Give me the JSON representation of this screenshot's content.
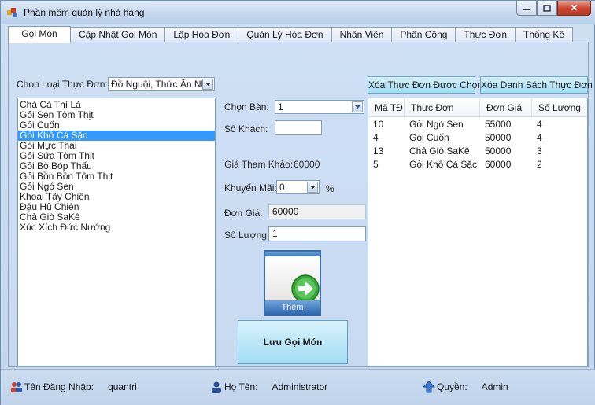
{
  "window": {
    "title": "Phần mềm quản lý nhà hàng"
  },
  "tabs": [
    {
      "label": "Gọi Món",
      "active": true
    },
    {
      "label": "Cập Nhật Gọi Món"
    },
    {
      "label": "Lập Hóa Đơn"
    },
    {
      "label": "Quản Lý Hóa Đơn"
    },
    {
      "label": "Nhân Viên"
    },
    {
      "label": "Phân Công"
    },
    {
      "label": "Thực Đơn"
    },
    {
      "label": "Thống Kê"
    }
  ],
  "category": {
    "label": "Chọn Loại Thực Đơn:",
    "value": "Đồ Nguội, Thức Ăn Nha"
  },
  "menu_list": {
    "items": [
      "Chả Cá Thì Là",
      "Gỏi Sen Tôm Thịt",
      "Gỏi Cuốn",
      "Gỏi Khô Cá Sặc",
      "Gỏi Mực Thái",
      "Gỏi Sứa Tôm Thịt",
      "Gỏi Bò Bóp Thấu",
      "Gỏi Bồn Bồn Tôm Thịt",
      "Gỏi Ngó Sen",
      "Khoai Tây Chiên",
      "Đậu Hủ Chiên",
      "Chả Giò SaKê",
      "Xúc Xích Đức Nướng"
    ],
    "selected_index": 3
  },
  "form": {
    "table_label": "Chọn Bàn:",
    "table_value": "1",
    "guests_label": "Số Khách:",
    "guests_value": "",
    "ref_price_label": "Giá Tham Khảo:",
    "ref_price_value": "60000",
    "discount_label": "Khuyến Mãi:",
    "discount_value": "0",
    "discount_unit": "%",
    "unit_price_label": "Đơn Giá:",
    "unit_price_value": "60000",
    "qty_label": "Số Lượng:",
    "qty_value": "1"
  },
  "add_button": {
    "label": "Thêm"
  },
  "save_button": {
    "label": "Lưu Gọi Món"
  },
  "actions": {
    "delete_selected": "Xóa Thực Đơn Được Chọn",
    "delete_all": "Xóa Danh Sách Thực Đơn"
  },
  "order_grid": {
    "columns": [
      "Mã TĐ",
      "Thực Đơn",
      "Đơn Giá",
      "Số Lượng"
    ],
    "rows": [
      [
        "10",
        "Gỏi Ngó Sen",
        "55000",
        "4"
      ],
      [
        "4",
        "Gỏi Cuốn",
        "50000",
        "4"
      ],
      [
        "13",
        "Chả Giò SaKê",
        "50000",
        "3"
      ],
      [
        "5",
        "Gỏi Khô Cá Sặc",
        "60000",
        "2"
      ]
    ]
  },
  "status": {
    "login_label": "Tên Đăng Nhập:",
    "login_value": "quantri",
    "name_label": "Họ Tên:",
    "name_value": "Administrator",
    "role_label": "Quyền:",
    "role_value": "Admin"
  },
  "icons": [
    "app-icon",
    "minimize-icon",
    "maximize-icon",
    "close-icon",
    "dropdown-arrow-icon",
    "arrow-right-icon",
    "users-icon",
    "user-icon",
    "upload-arrow-icon"
  ],
  "colors": {
    "selection": "#3399ff",
    "button_blue": "#a3dcf2",
    "window_bg": "#c8daf0"
  }
}
